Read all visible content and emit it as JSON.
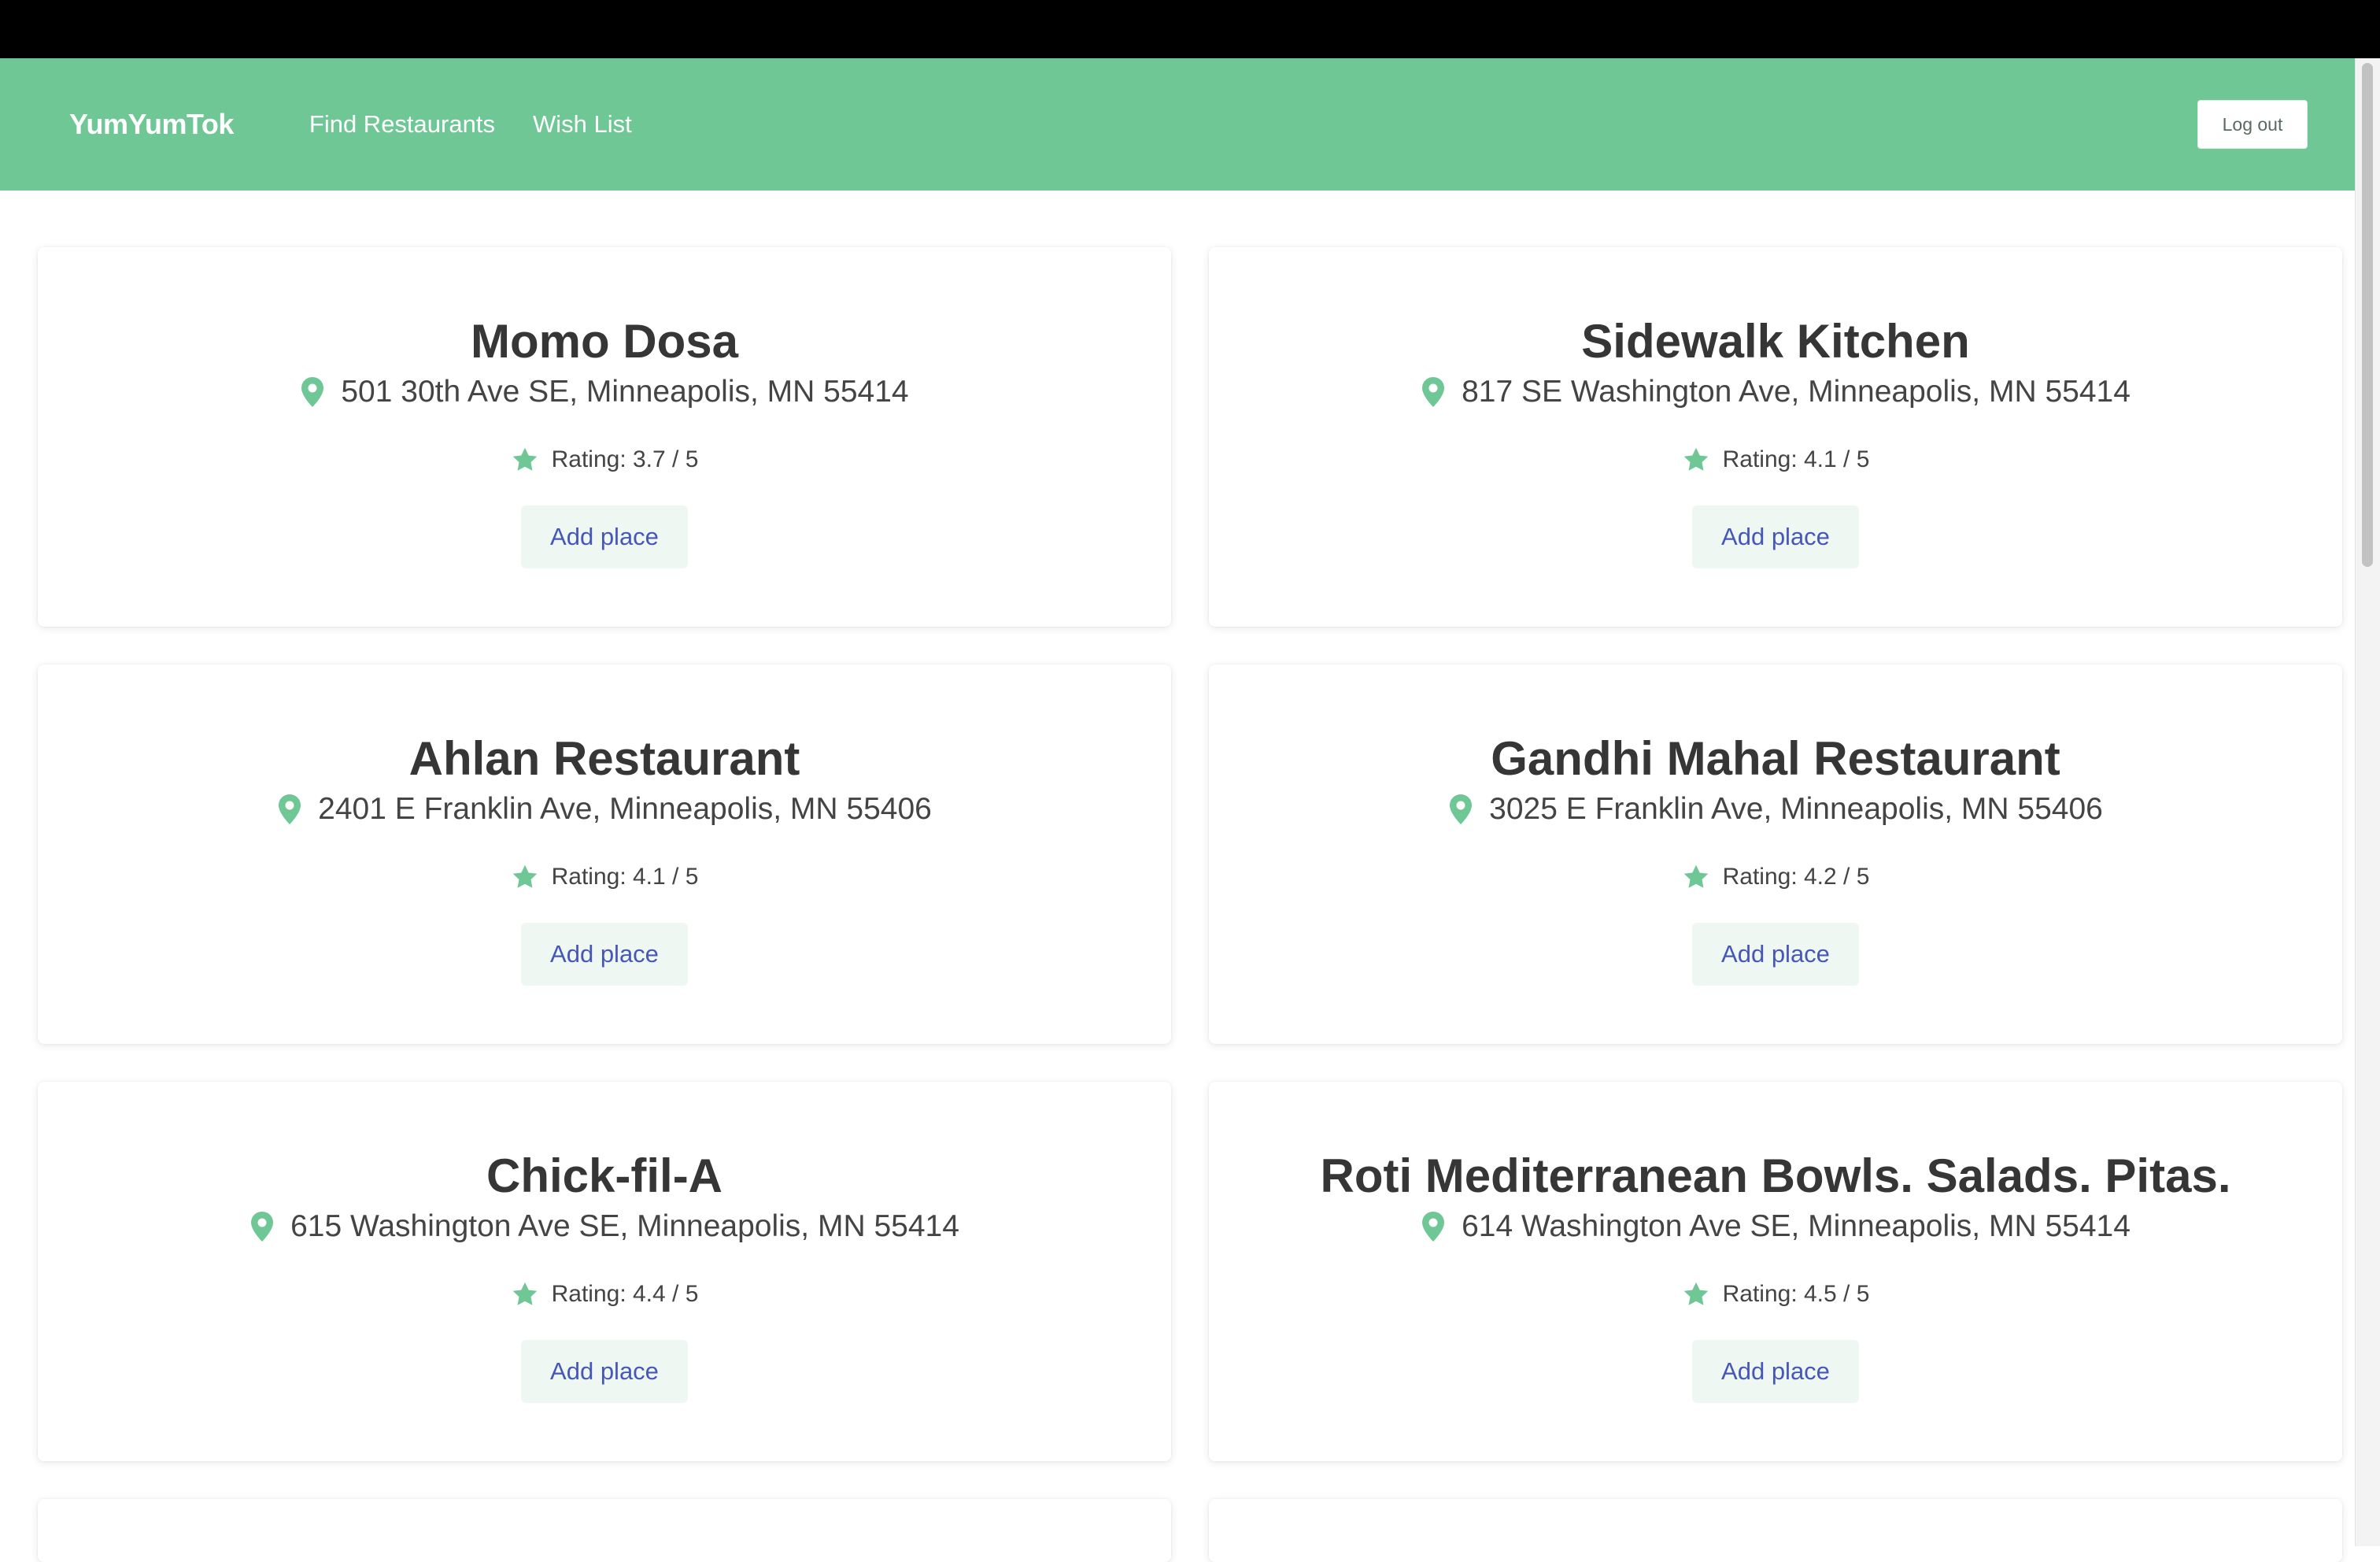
{
  "app": {
    "brand": "YumYumTok",
    "accent_color": "#6ec794",
    "link_color": "#4657b8"
  },
  "nav": {
    "links": [
      "Find Restaurants",
      "Wish List"
    ],
    "logout_label": "Log out"
  },
  "restaurants": [
    {
      "name": "Momo Dosa",
      "address": "501 30th Ave SE, Minneapolis, MN 55414",
      "rating": "Rating: 3.7 / 5",
      "button": "Add place"
    },
    {
      "name": "Sidewalk Kitchen",
      "address": "817 SE Washington Ave, Minneapolis, MN 55414",
      "rating": "Rating: 4.1 / 5",
      "button": "Add place"
    },
    {
      "name": "Ahlan Restaurant",
      "address": "2401 E Franklin Ave, Minneapolis, MN 55406",
      "rating": "Rating: 4.1 / 5",
      "button": "Add place"
    },
    {
      "name": "Gandhi Mahal Restaurant",
      "address": "3025 E Franklin Ave, Minneapolis, MN 55406",
      "rating": "Rating: 4.2 / 5",
      "button": "Add place"
    },
    {
      "name": "Chick-fil-A",
      "address": "615 Washington Ave SE, Minneapolis, MN 55414",
      "rating": "Rating: 4.4 / 5",
      "button": "Add place"
    },
    {
      "name": "Roti Mediterranean Bowls. Salads. Pitas.",
      "address": "614 Washington Ave SE, Minneapolis, MN 55414",
      "rating": "Rating: 4.5 / 5",
      "button": "Add place"
    }
  ],
  "icons": {
    "location": "map-pin-icon",
    "rating": "star-icon"
  }
}
